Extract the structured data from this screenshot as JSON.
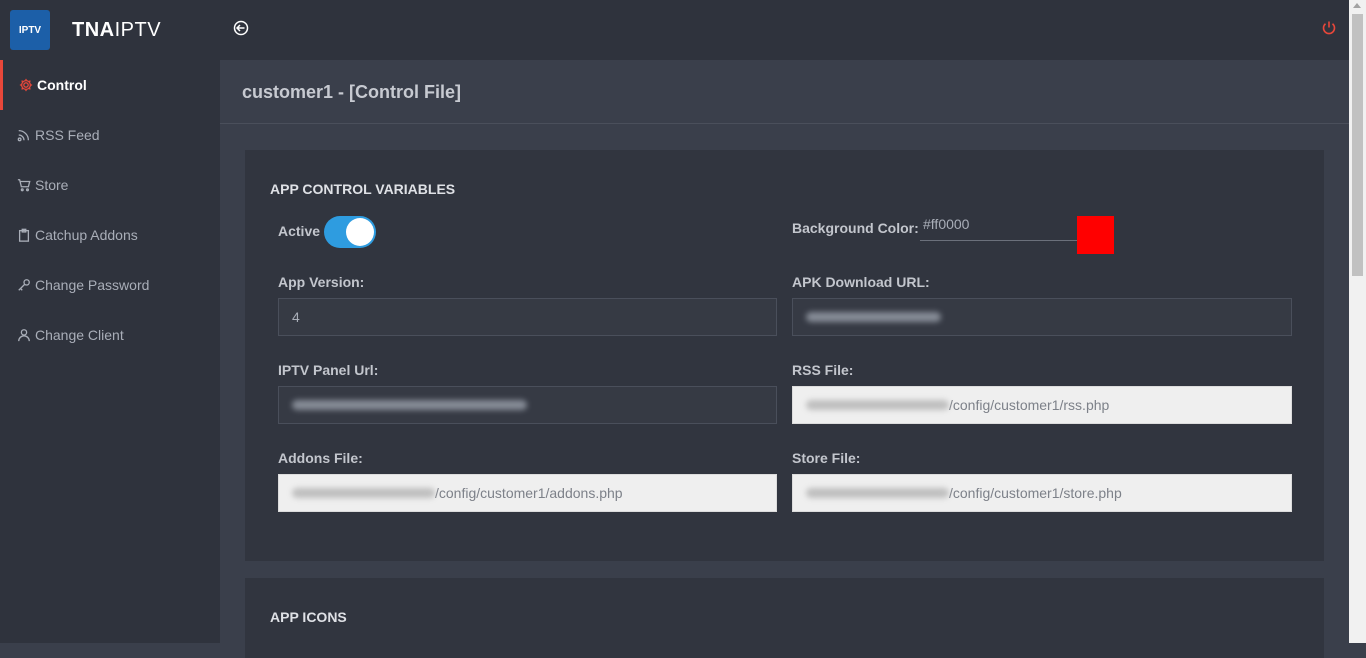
{
  "brand": {
    "logo_text": "IPTV",
    "name_bold": "TNA",
    "name_light": "IPTV"
  },
  "sidebar": {
    "items": [
      {
        "label": "Control",
        "icon": "gear-icon",
        "active": true
      },
      {
        "label": "RSS Feed",
        "icon": "rss-icon",
        "active": false
      },
      {
        "label": "Store",
        "icon": "cart-icon",
        "active": false
      },
      {
        "label": "Catchup Addons",
        "icon": "clipboard-icon",
        "active": false
      },
      {
        "label": "Change Password",
        "icon": "key-icon",
        "active": false
      },
      {
        "label": "Change Client",
        "icon": "user-icon",
        "active": false
      }
    ]
  },
  "topbar": {
    "back_icon": "back-arrow-icon",
    "power_icon": "power-icon"
  },
  "page": {
    "title": "customer1 - [Control File]"
  },
  "control_card": {
    "title": "APP CONTROL VARIABLES",
    "active_label": "Active",
    "active_value": true,
    "bg_color_label": "Background Color:",
    "bg_color_value": "#ff0000",
    "app_version_label": "App Version:",
    "app_version_value": "4",
    "apk_url_label": "APK Download URL:",
    "iptv_panel_label": "IPTV Panel Url:",
    "rss_file_label": "RSS File:",
    "rss_file_value": "/config/customer1/rss.php",
    "addons_file_label": "Addons File:",
    "addons_file_value": "/config/customer1/addons.php",
    "store_file_label": "Store File:",
    "store_file_value": "/config/customer1/store.php"
  },
  "icons_card": {
    "title": "APP ICONS"
  },
  "colors": {
    "accent": "#e8473a",
    "toggle": "#2e9ce0",
    "swatch": "#ff0000"
  }
}
